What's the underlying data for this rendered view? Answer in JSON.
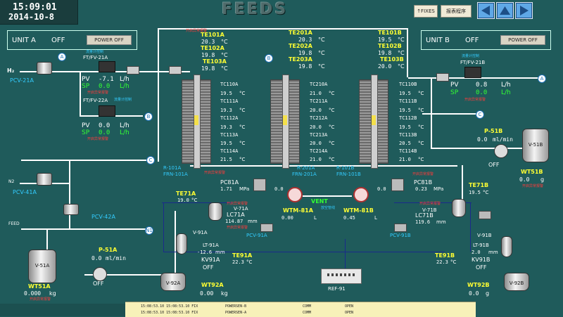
{
  "header": {
    "time": "15:09:01",
    "date": "2014-10-8",
    "title": "FEEDS",
    "btn_fixes": "↑FIXES",
    "btn_report": "报表程序",
    "nav_prev": "previous-screen",
    "nav_up": "up-screen",
    "nav_next": "next-screen"
  },
  "unit_a": {
    "label": "UNIT A",
    "state": "OFF",
    "power_label": "POWER OFF"
  },
  "unit_b": {
    "label": "UNIT B",
    "state": "OFF",
    "power_label": "POWER OFF"
  },
  "tags": {
    "a": "A",
    "b": "B",
    "c": "C",
    "n1": "N1"
  },
  "feed_left": {
    "h2": "H₂",
    "pcv21a": "PCV-21A",
    "ftfv21a": "FT/FV-21A",
    "ftfv21a_cn": "流量计控制",
    "pv_label": "PV",
    "pv1": "-7.1",
    "sp_label": "SP",
    "sp1": "0.0",
    "unit_lh": "L/h",
    "alarm_cn1": "开启异常报警",
    "ftfv22a": "FT/FV-22A",
    "ftfv22a_cn": "流量计控制",
    "pv2": "0.0",
    "sp2": "0.0",
    "alarm_cn2": "开启异常报警",
    "n2": "N2",
    "pcv41a": "PCV-41A",
    "pcv42a": "PCV-42A",
    "feed": "FEED",
    "v51a": "V-51A",
    "wt51a": "WT51A",
    "wt51a_val": "0.000",
    "wt51a_unit": "kg",
    "wt51a_cn": "开启异常报警",
    "p51a": "P-51A",
    "p51a_val": "0.0",
    "p51a_unit": "ml/min",
    "p51a_state": "OFF"
  },
  "reactor_a": {
    "te": [
      {
        "tag": "TE101A",
        "val": "20.3"
      },
      {
        "tag": "TE102A",
        "val": "19.8"
      },
      {
        "tag": "TE103A",
        "val": "19.8"
      }
    ],
    "unit_c": "°C",
    "tc": [
      {
        "tag": "TC110A",
        "val": "19.5"
      },
      {
        "tag": "TC111A",
        "val": "19.3"
      },
      {
        "tag": "TC112A",
        "val": "19.3"
      },
      {
        "tag": "TC113A",
        "val": "19.5"
      },
      {
        "tag": "TC114A",
        "val": "21.5"
      }
    ],
    "r101a": "R-101A",
    "frn101a": "FRN-101A",
    "warn": "开启异常报警"
  },
  "reactor_mid": {
    "te": [
      {
        "tag": "TE201A",
        "val": "20.3"
      },
      {
        "tag": "TE202A",
        "val": "19.8"
      },
      {
        "tag": "TE203A",
        "val": "19.8"
      }
    ],
    "tc": [
      {
        "tag": "TC210A",
        "val": "21.0"
      },
      {
        "tag": "TC211A",
        "val": "20.0"
      },
      {
        "tag": "TC212A",
        "val": "20.0"
      },
      {
        "tag": "TC213A",
        "val": "20.0"
      },
      {
        "tag": "TC214A",
        "val": "21.0"
      }
    ],
    "r201a": "R-201A",
    "frn201a": "FRN-201A"
  },
  "reactor_b": {
    "te": [
      {
        "tag": "TE101B",
        "val": "19.5"
      },
      {
        "tag": "TE102B",
        "val": "19.8"
      },
      {
        "tag": "TE103B",
        "val": "20.0"
      }
    ],
    "tc": [
      {
        "tag": "TC110B",
        "val": "19.5"
      },
      {
        "tag": "TC111B",
        "val": "19.5"
      },
      {
        "tag": "TC112B",
        "val": "19.5"
      },
      {
        "tag": "TC113B",
        "val": "20.5"
      },
      {
        "tag": "TC114B",
        "val": "21.0"
      }
    ],
    "r101b": "R-101B",
    "frn101b": "FRN-101B"
  },
  "feed_right": {
    "ftfv21b": "FT/FV-21B",
    "ftfv21b_cn": "流量计控制",
    "pv": "0.8",
    "sp": "0.0",
    "unit_lh": "L/h",
    "alarm_cn": "开启异常报警",
    "p51b": "P-51B",
    "p51b_val": "0.0",
    "p51b_unit": "ml/min",
    "p51b_state": "OFF",
    "v51b": "V-51B",
    "wt51b": "WT51B",
    "wt51b_val": "0.0",
    "wt51b_unit": "g",
    "wt51b_cn": "开启异常报警"
  },
  "separator_a": {
    "te71a": "TE71A",
    "te71a_val": "19.0",
    "unit_c": "°C",
    "pc81a": "PC81A",
    "pc81a_val": "1.71",
    "pc81a_unit": "MPa",
    "pc81a_warn": "开启异常报警",
    "v71a": "V-71A",
    "lc71a": "LC71A",
    "lc71a_val": "114.87",
    "lc71a_unit": "mm",
    "lc71a_warn": "开启异常报警",
    "pcv91a": "PCV-91A",
    "v91a": "V-91A",
    "lt91a": "LT-91A",
    "lt91a_val": "-12.6",
    "lt91a_unit": "mm",
    "kv91a": "KV91A",
    "kv91a_state": "OFF",
    "te91a": "TE91A",
    "te91a_val": "22.3",
    "v92a": "V-92A",
    "wt92a": "WT92A",
    "wt92a_val": "0.00",
    "wt92a_unit": "kg",
    "valve_val": "0.0",
    "wtm81a": "WTM-81A",
    "wtm81a_val": "0.00",
    "wtm81a_unit": "L"
  },
  "separator_b": {
    "te71b": "TE71B",
    "te71b_val": "19.5",
    "pc81b": "PC81B",
    "pc81b_val": "0.23",
    "pc81b_unit": "MPa",
    "pc81b_warn": "开启异常报警",
    "v71b": "V-71B",
    "lc71b": "LC71B",
    "lc71b_val": "119.6",
    "lc71b_unit": "mm",
    "lc71b_warn": "开启异常报警",
    "pcv91b": "PCV-91B",
    "v91b": "V-91B",
    "lt91b": "LT-91B",
    "lt91b_val": "2.0",
    "lt91b_unit": "mm",
    "kv91b": "KV91B",
    "kv91b_state": "OFF",
    "te91b": "TE91B",
    "te91b_val": "22.3",
    "v92b": "V-92B",
    "wt92b": "WT92B",
    "wt92b_val": "0.0",
    "wt92b_unit": "g",
    "valve_val": "0.0",
    "wtm81b": "WTM-81B",
    "wtm81b_val": "0.45",
    "wtm81b_unit": "L"
  },
  "center": {
    "vent": "VENT",
    "vent_cn": "放空管线",
    "ref91": "REF-91"
  },
  "alarms": [
    {
      "time": "15:08:53.10 15:08:53.10 FIX",
      "source": "POWERSEN-B",
      "type": "COMM",
      "state": "OPEN"
    },
    {
      "time": "15:08:53.10 15:08:53.10 FIX",
      "source": "POWERSEN-A",
      "type": "COMM",
      "state": "OPEN"
    }
  ],
  "colors": {
    "background": "#1f5b5b",
    "alarm_bar": "#f7f1b9",
    "value_white": "#ffffff",
    "label_yellow": "#ffff33",
    "sp_green": "#33ff33",
    "warn_red": "#ff3b3b"
  }
}
